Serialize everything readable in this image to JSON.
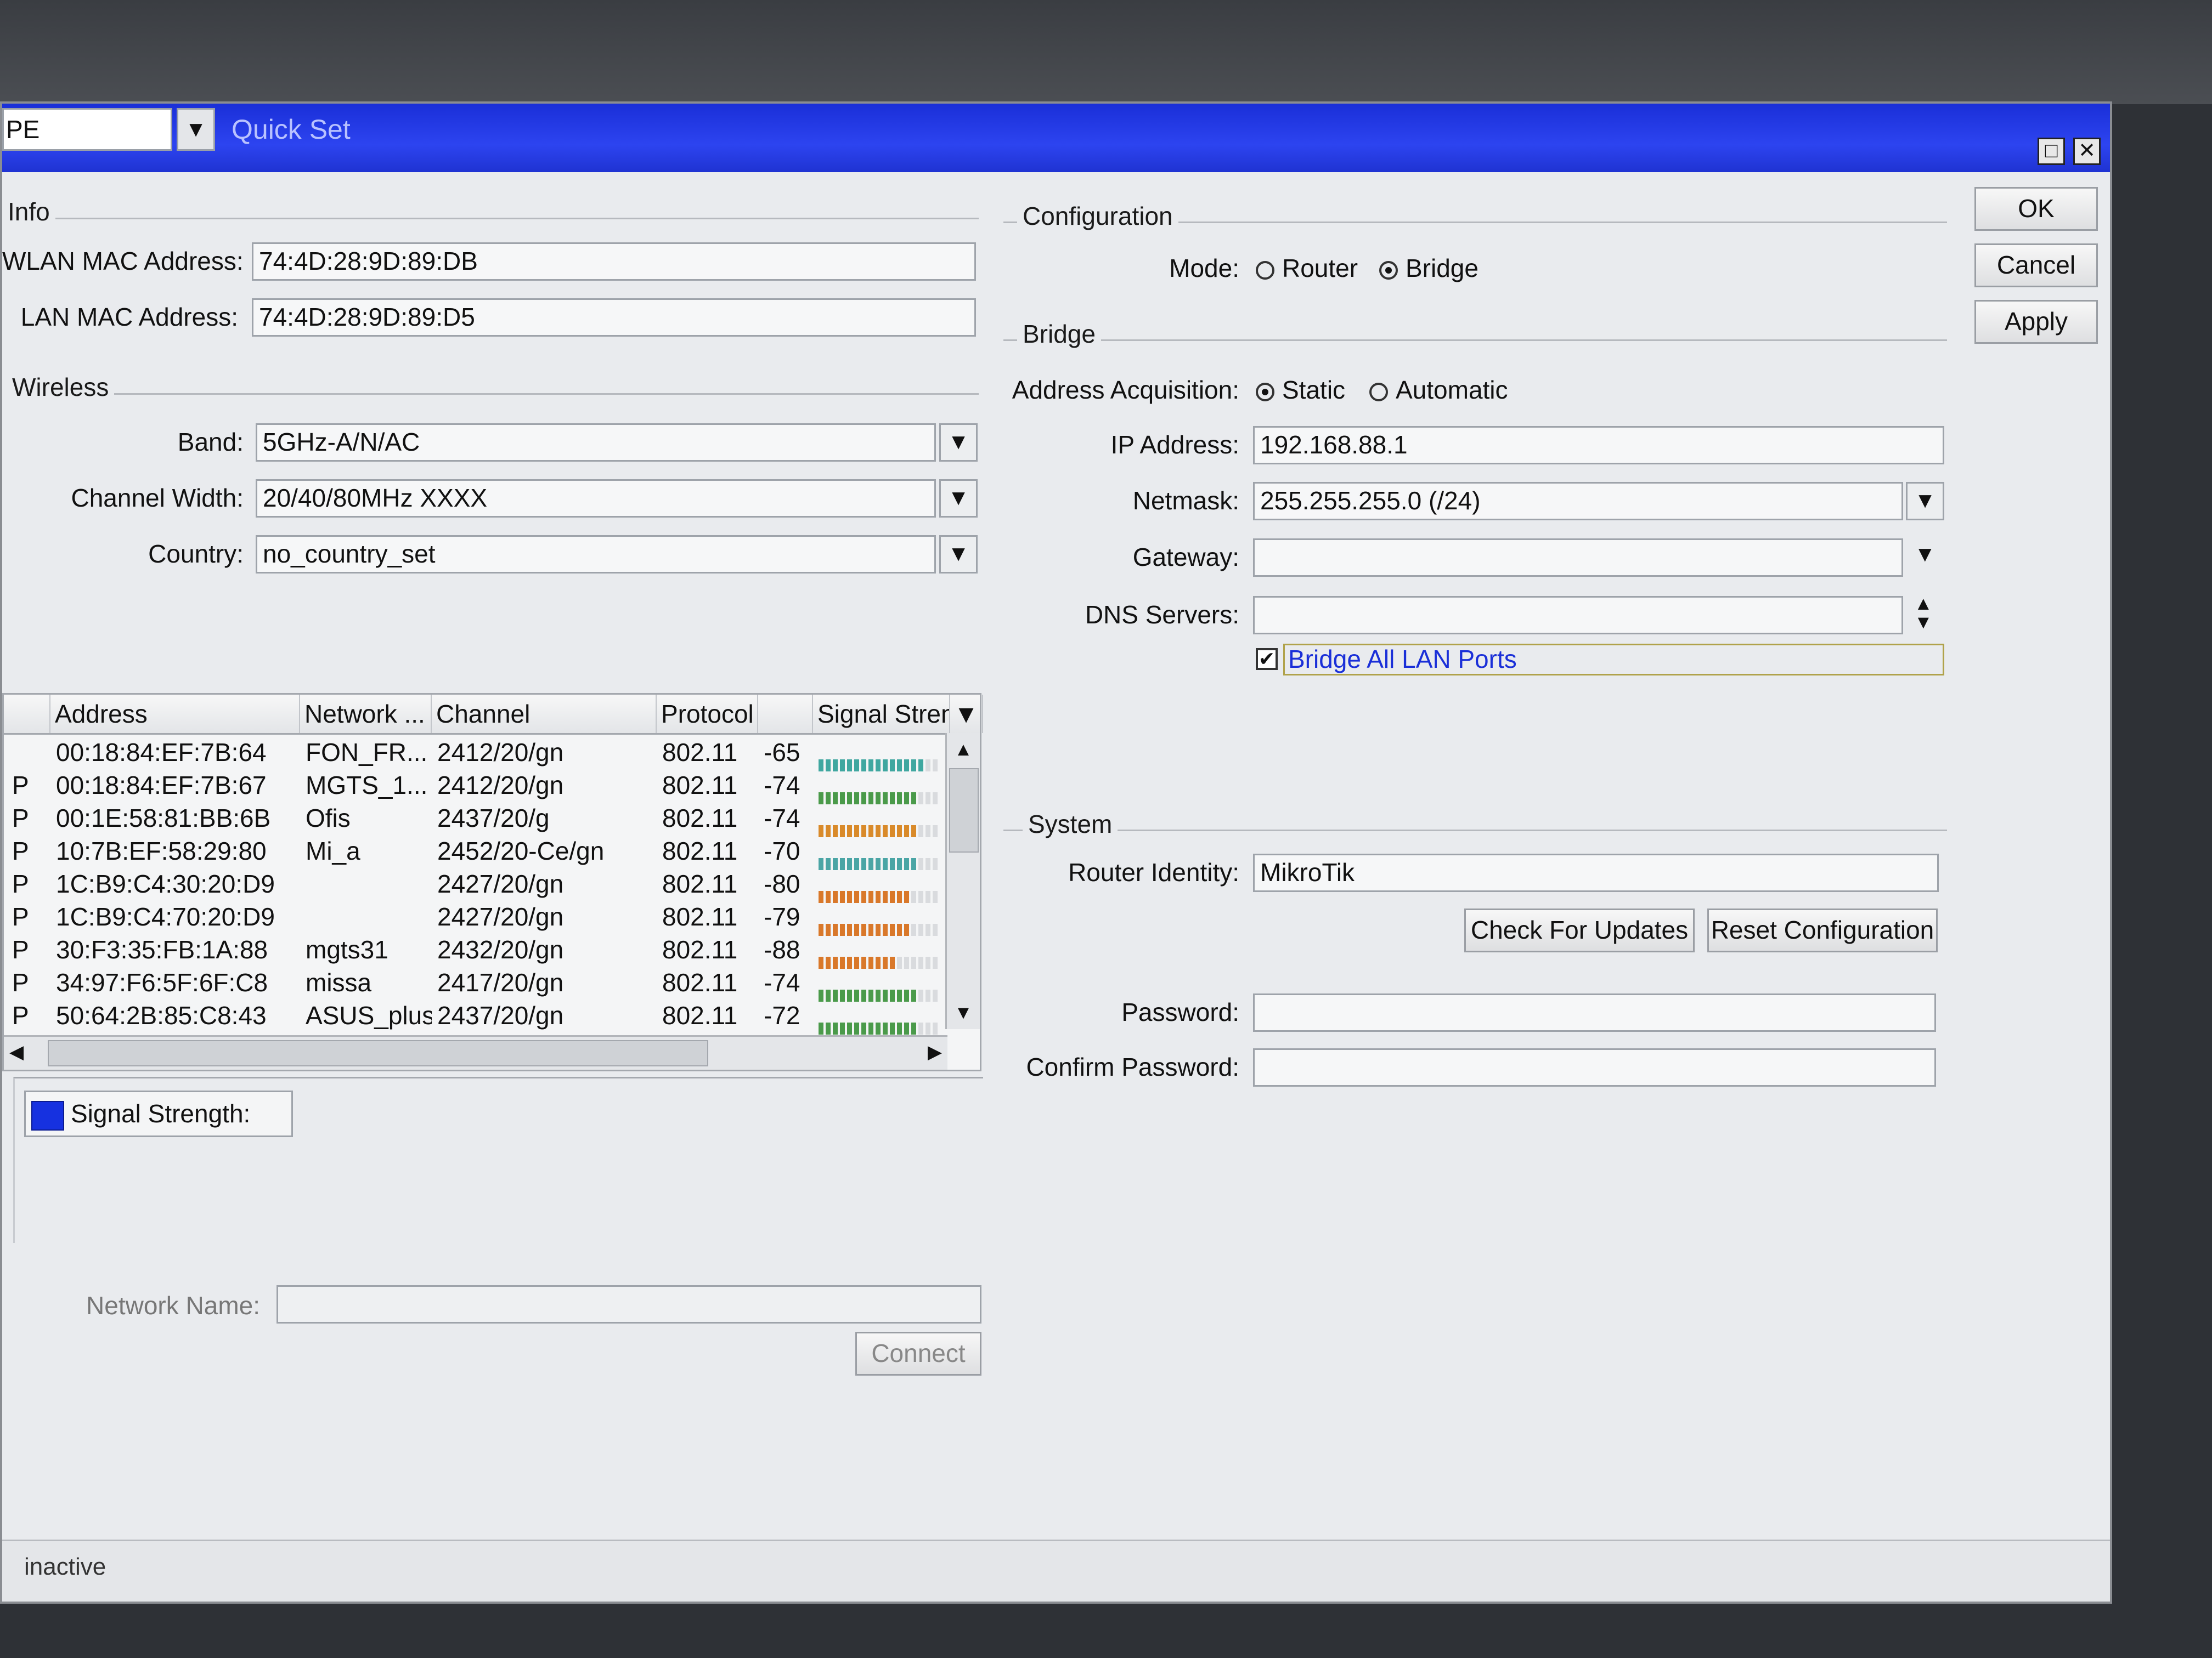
{
  "window": {
    "profile": "PE",
    "title": "Quick Set"
  },
  "buttons": {
    "ok": "OK",
    "cancel": "Cancel",
    "apply": "Apply"
  },
  "info": {
    "section": "Info",
    "wlan_mac_label": "WLAN MAC Address:",
    "wlan_mac": "74:4D:28:9D:89:DB",
    "lan_mac_label": "LAN MAC Address:",
    "lan_mac": "74:4D:28:9D:89:D5"
  },
  "wireless": {
    "section": "Wireless",
    "band_label": "Band:",
    "band": "5GHz-A/N/AC",
    "channel_width_label": "Channel Width:",
    "channel_width": "20/40/80MHz XXXX",
    "country_label": "Country:",
    "country": "no_country_set"
  },
  "scan_table": {
    "columns": [
      "Address",
      "Network ...",
      "Channel",
      "Protocol",
      "Signal Stren"
    ],
    "rows": [
      {
        "flag": "",
        "address": "00:18:84:EF:7B:64",
        "network": "FON_FR...",
        "channel": "2412/20/gn",
        "protocol": "802.11",
        "signal": "-65",
        "bar_color": "#3fa7a0"
      },
      {
        "flag": "P",
        "address": "00:18:84:EF:7B:67",
        "network": "MGTS_1...",
        "channel": "2412/20/gn",
        "protocol": "802.11",
        "signal": "-74",
        "bar_color": "#4a9a4a"
      },
      {
        "flag": "P",
        "address": "00:1E:58:81:BB:6B",
        "network": "Ofis",
        "channel": "2437/20/g",
        "protocol": "802.11",
        "signal": "-74",
        "bar_color": "#d98a2a"
      },
      {
        "flag": "P",
        "address": "10:7B:EF:58:29:80",
        "network": "Mi_a",
        "channel": "2452/20-Ce/gn",
        "protocol": "802.11",
        "signal": "-70",
        "bar_color": "#4aa5a5"
      },
      {
        "flag": "P",
        "address": "1C:B9:C4:30:20:D9",
        "network": "",
        "channel": "2427/20/gn",
        "protocol": "802.11",
        "signal": "-80",
        "bar_color": "#d9782a"
      },
      {
        "flag": "P",
        "address": "1C:B9:C4:70:20:D9",
        "network": "",
        "channel": "2427/20/gn",
        "protocol": "802.11",
        "signal": "-79",
        "bar_color": "#d9782a"
      },
      {
        "flag": "P",
        "address": "30:F3:35:FB:1A:88",
        "network": "mgts31",
        "channel": "2432/20/gn",
        "protocol": "802.11",
        "signal": "-88",
        "bar_color": "#d9782a"
      },
      {
        "flag": "P",
        "address": "34:97:F6:5F:6F:C8",
        "network": "missa",
        "channel": "2417/20/gn",
        "protocol": "802.11",
        "signal": "-74",
        "bar_color": "#4a9a4a"
      },
      {
        "flag": "P",
        "address": "50:64:2B:85:C8:43",
        "network": "ASUS_plus",
        "channel": "2437/20/gn",
        "protocol": "802.11",
        "signal": "-72",
        "bar_color": "#4a9a4a"
      }
    ]
  },
  "signal_legend": "Signal Strength:",
  "network_name_label": "Network Name:",
  "network_name": "",
  "connect_button": "Connect",
  "configuration": {
    "section": "Configuration",
    "mode_label": "Mode:",
    "mode_router": "Router",
    "mode_bridge": "Bridge",
    "mode_selected": "Bridge"
  },
  "bridge": {
    "section": "Bridge",
    "acq_label": "Address Acquisition:",
    "acq_static": "Static",
    "acq_automatic": "Automatic",
    "acq_selected": "Static",
    "ip_label": "IP Address:",
    "ip": "192.168.88.1",
    "netmask_label": "Netmask:",
    "netmask": "255.255.255.0 (/24)",
    "gateway_label": "Gateway:",
    "gateway": "",
    "dns_label": "DNS Servers:",
    "dns": "",
    "bridge_all_lan": "Bridge All LAN Ports",
    "bridge_all_lan_checked": true
  },
  "system": {
    "section": "System",
    "identity_label": "Router Identity:",
    "identity": "MikroTik",
    "check_updates": "Check For Updates",
    "reset_config": "Reset Configuration",
    "password_label": "Password:",
    "password": "",
    "confirm_label": "Confirm Password:",
    "confirm": ""
  },
  "status": "inactive",
  "colors": {
    "titlebar": "#2d44f0",
    "signal_swatch": "#1631e0",
    "link": "#1a2fd8"
  }
}
